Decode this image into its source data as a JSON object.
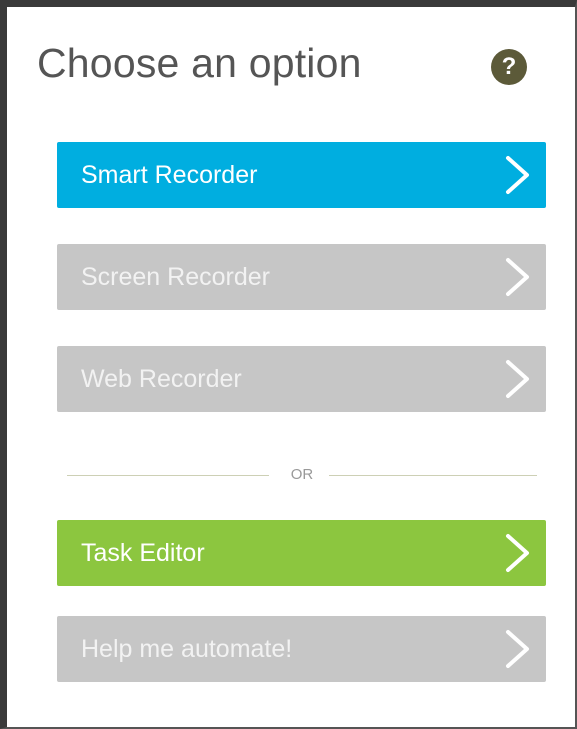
{
  "header": {
    "title": "Choose an option",
    "help_glyph": "?"
  },
  "options": [
    {
      "label": "Smart Recorder",
      "color": "#00aee0",
      "state": "active"
    },
    {
      "label": "Screen Recorder",
      "color": "#c6c6c6",
      "state": "disabled"
    },
    {
      "label": "Web Recorder",
      "color": "#c6c6c6",
      "state": "disabled"
    },
    {
      "label": "Task Editor",
      "color": "#8cc63f",
      "state": "active"
    },
    {
      "label": "Help me automate!",
      "color": "#c6c6c6",
      "state": "disabled"
    }
  ],
  "divider": {
    "label": "OR"
  },
  "icons": {
    "help": "help-icon",
    "chevron": "chevron-right-icon"
  }
}
